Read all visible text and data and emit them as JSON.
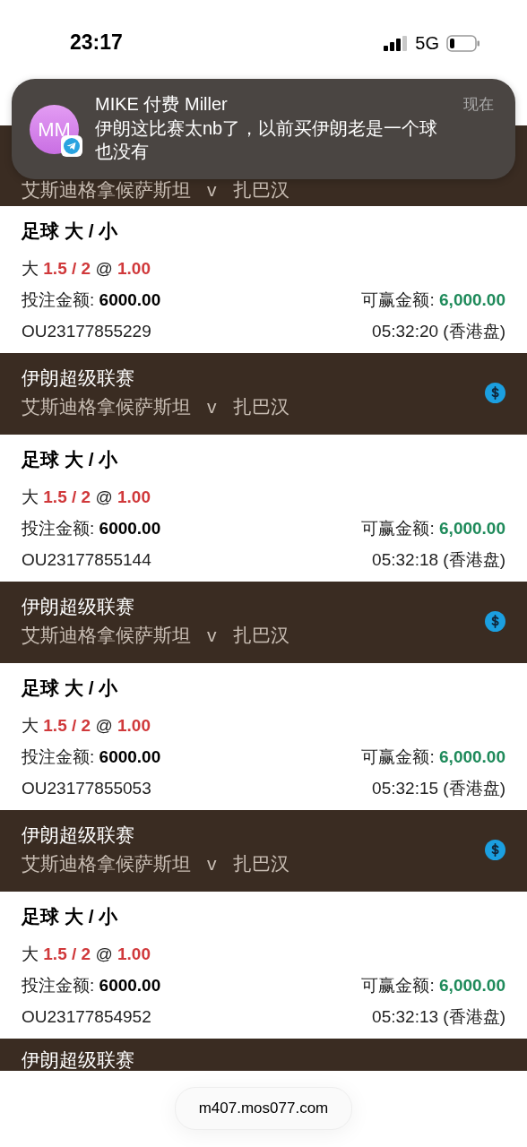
{
  "status_bar": {
    "time": "23:17",
    "network": "5G"
  },
  "notification": {
    "avatar_initials": "MM",
    "sender": "MIKE 付费 Miller",
    "time": "现在",
    "message": "伊朗这比赛太nb了，以前买伊朗老是一个球也没有"
  },
  "sections": [
    {
      "kind": "event",
      "home": "艾斯迪格拿候萨斯坦",
      "vs": "v",
      "away": "扎巴汉",
      "has_coin": false
    },
    {
      "kind": "bet",
      "title": "足球 大 / 小",
      "selection": "大",
      "line": "1.5 / 2",
      "at": "@",
      "odds": "1.00",
      "stake_label": "投注金额:",
      "stake": "6000.00",
      "win_label": "可赢金额:",
      "win": "6,000.00",
      "ref": "OU23177855229",
      "time": "05:32:20 (香港盘)"
    },
    {
      "kind": "event",
      "league": "伊朗超级联赛",
      "home": "艾斯迪格拿候萨斯坦",
      "vs": "v",
      "away": "扎巴汉",
      "has_coin": true
    },
    {
      "kind": "bet",
      "title": "足球 大 / 小",
      "selection": "大",
      "line": "1.5 / 2",
      "at": "@",
      "odds": "1.00",
      "stake_label": "投注金额:",
      "stake": "6000.00",
      "win_label": "可赢金额:",
      "win": "6,000.00",
      "ref": "OU23177855144",
      "time": "05:32:18 (香港盘)"
    },
    {
      "kind": "event",
      "league": "伊朗超级联赛",
      "home": "艾斯迪格拿候萨斯坦",
      "vs": "v",
      "away": "扎巴汉",
      "has_coin": true
    },
    {
      "kind": "bet",
      "title": "足球 大 / 小",
      "selection": "大",
      "line": "1.5 / 2",
      "at": "@",
      "odds": "1.00",
      "stake_label": "投注金额:",
      "stake": "6000.00",
      "win_label": "可赢金额:",
      "win": "6,000.00",
      "ref": "OU23177855053",
      "time": "05:32:15 (香港盘)"
    },
    {
      "kind": "event",
      "league": "伊朗超级联赛",
      "home": "艾斯迪格拿候萨斯坦",
      "vs": "v",
      "away": "扎巴汉",
      "has_coin": true
    },
    {
      "kind": "bet",
      "title": "足球 大 / 小",
      "selection": "大",
      "line": "1.5 / 2",
      "at": "@",
      "odds": "1.00",
      "stake_label": "投注金额:",
      "stake": "6000.00",
      "win_label": "可赢金额:",
      "win": "6,000.00",
      "ref": "OU23177854952",
      "time": "05:32:13 (香港盘)"
    },
    {
      "kind": "event",
      "league": "伊朗超级联赛",
      "has_coin": false
    }
  ],
  "address_bar": {
    "url": "m407.mos077.com"
  }
}
